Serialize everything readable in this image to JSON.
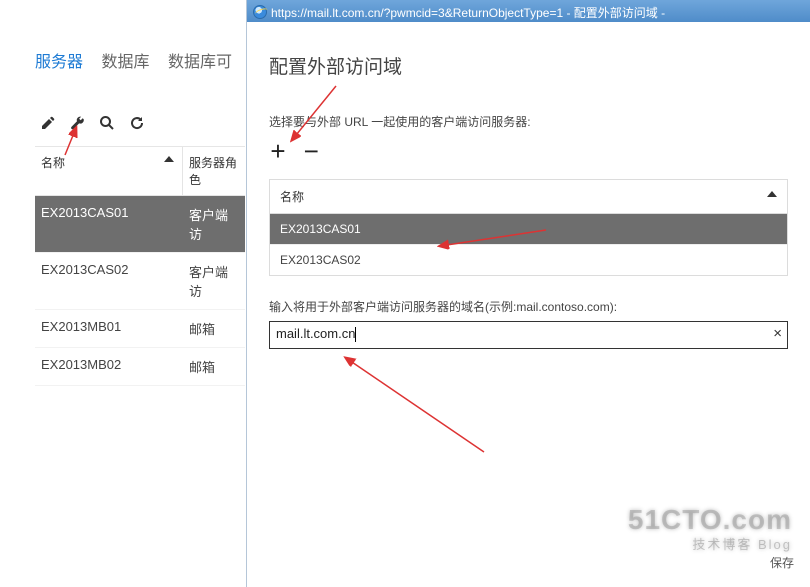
{
  "tabs": {
    "servers": "服务器",
    "db": "数据库",
    "db_avail": "数据库可"
  },
  "grid": {
    "col_name": "名称",
    "col_role": "服务器角色",
    "rows": [
      {
        "name": "EX2013CAS01",
        "role": "客户端访",
        "selected": true
      },
      {
        "name": "EX2013CAS02",
        "role": "客户端访",
        "selected": false
      },
      {
        "name": "EX2013MB01",
        "role": "邮箱",
        "selected": false
      },
      {
        "name": "EX2013MB02",
        "role": "邮箱",
        "selected": false
      }
    ]
  },
  "dialog": {
    "url": "https://mail.lt.com.cn/?pwmcid=3&ReturnObjectType=1 - 配置外部访问域 -",
    "title": "配置外部访问域",
    "instruct": "选择要与外部 URL 一起使用的客户端访问服务器:",
    "inner_th": "名称",
    "inner_rows": [
      {
        "name": "EX2013CAS01",
        "selected": true
      },
      {
        "name": "EX2013CAS02",
        "selected": false
      }
    ],
    "domain_label": "输入将用于外部客户端访问服务器的域名(示例:mail.contoso.com):",
    "domain_value": "mail.lt.com.cn",
    "save": "保存"
  },
  "watermark": {
    "big": "51CTO.com",
    "sub": "技术博客  Blog"
  }
}
